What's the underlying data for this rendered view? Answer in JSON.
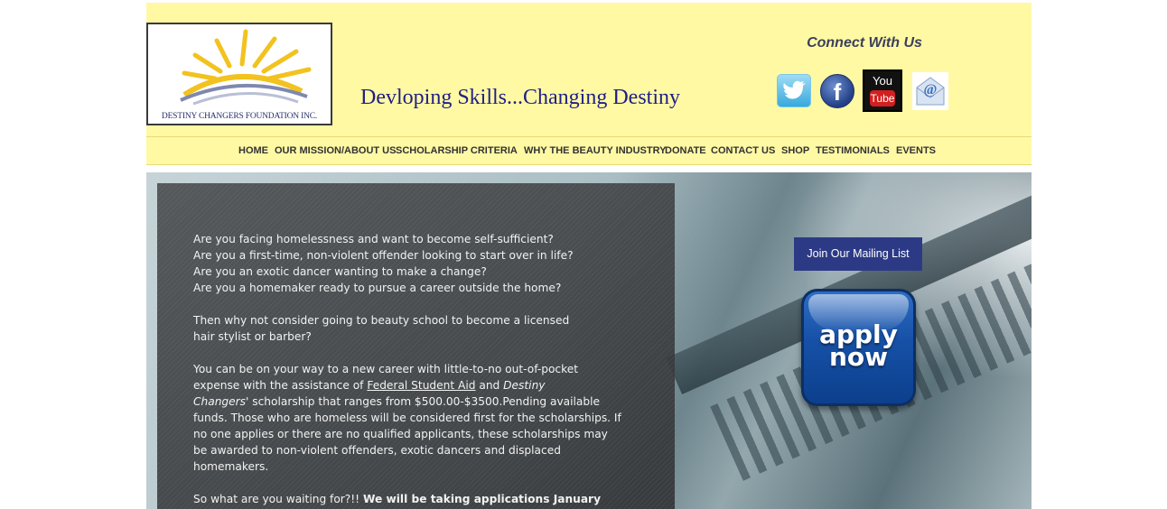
{
  "header": {
    "logo_text": "DESTINY CHANGERS FOUNDATION INC.",
    "tagline": "Devloping Skills...Changing Destiny",
    "connect_title": "Connect With Us",
    "social": [
      {
        "name": "twitter",
        "icon": "twitter-icon"
      },
      {
        "name": "facebook",
        "icon": "facebook-icon",
        "glyph": "f"
      },
      {
        "name": "youtube",
        "icon": "youtube-icon",
        "you": "You",
        "tube": "Tube"
      },
      {
        "name": "email",
        "icon": "email-icon",
        "glyph": "@"
      }
    ]
  },
  "nav": {
    "items": [
      "HOME",
      "OUR MISSION/ABOUT US",
      "SCHOLARSHIP CRITERIA",
      "WHY THE BEAUTY INDUSTRY",
      "DONATE",
      "CONTACT US",
      "SHOP",
      "TESTIMONIALS",
      "EVENTS"
    ]
  },
  "main": {
    "questions": [
      "Are you facing homelessness and want to become self-sufficient?",
      "Are you a  first-time, non-violent offender looking to start over in life?",
      "Are you an exotic dancer wanting to make a change?",
      "Are you a homemaker ready to pursue a career outside the home?"
    ],
    "paragraph2": [
      "Then why not consider going to beauty school to become a licensed",
      "hair stylist or barber?"
    ],
    "paragraph3": {
      "line1": "You can be on your way to a new career with little-to-no out-of-pocket",
      "line2_pre": "expense with the assistance of ",
      "link_text": "Federal Student Aid",
      "line2_mid": " and ",
      "line2_em": "Destiny",
      "line3_em": "Changers'",
      "line3_post": " scholarship that ranges from $500.00-$3500.Pending available",
      "rest": [
        "funds. Those who are homeless will be considered first for the scholarships. If",
        "no one applies or there are no qualified applicants, these scholarships may",
        "be awarded to non-violent offenders, exotic dancers and displaced",
        "homemakers."
      ]
    },
    "closing": {
      "pre": "So what are you waiting for?!! ",
      "bold": "We will be taking applications January"
    }
  },
  "sidebar": {
    "mailing_label": "Join Our Mailing List",
    "apply_label": "apply\nnow"
  },
  "colors": {
    "header_bg": "#fff9a4",
    "tagline": "#1f1f86",
    "mailing_bg": "#2c3a85",
    "apply_bg": "#1650a6"
  }
}
